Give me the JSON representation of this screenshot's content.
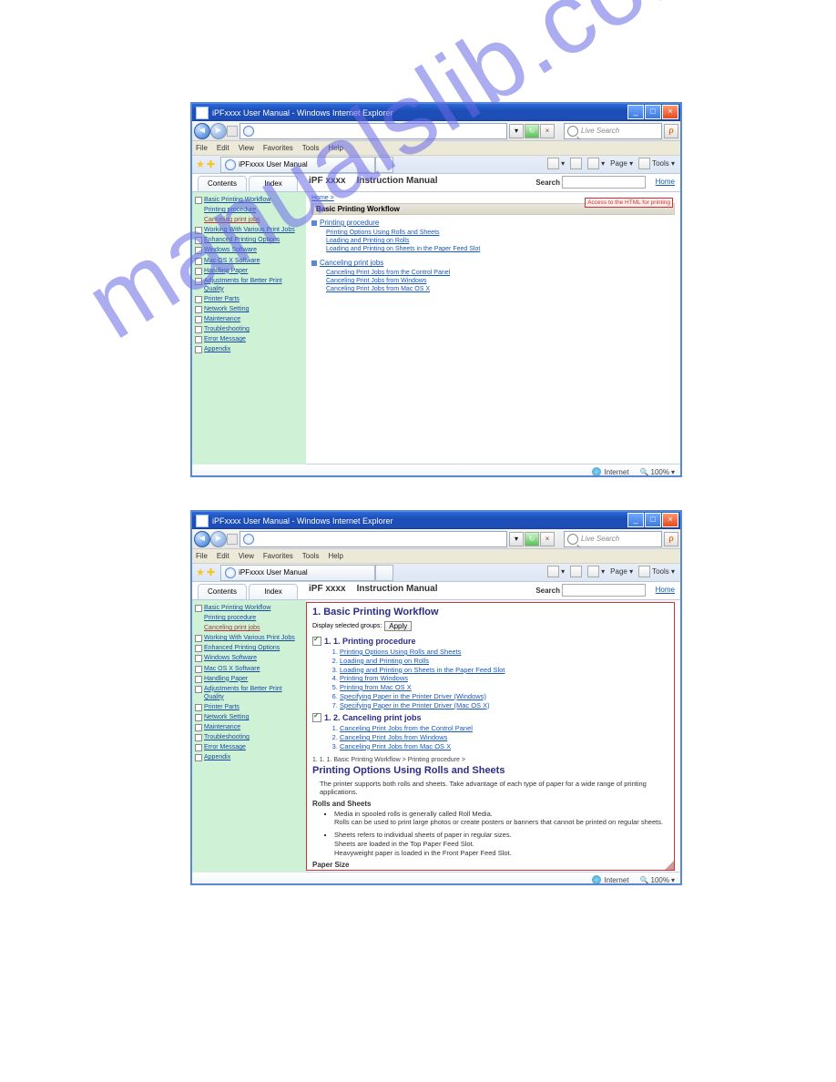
{
  "watermark": "manualslib.com",
  "win": {
    "title": "iPFxxxx User Manual - Windows Internet Explorer",
    "searchPlaceholder": "Live Search",
    "menus": [
      "File",
      "Edit",
      "View",
      "Favorites",
      "Tools",
      "Help"
    ],
    "tabTitle": "iPFxxxx User Manual",
    "tools": {
      "page": "Page ▾",
      "tools": "Tools ▾"
    }
  },
  "manual": {
    "tabContents": "Contents",
    "tabIndex": "Index",
    "product": "iPF xxxx",
    "subtitle": "Instruction Manual",
    "searchLabel": "Search",
    "home": "Home"
  },
  "sidebar": [
    {
      "type": "top",
      "label": "Basic Printing Workflow"
    },
    {
      "type": "sub",
      "label": "Printing procedure"
    },
    {
      "type": "subred",
      "label": "Canceling print jobs"
    },
    {
      "type": "top",
      "label": "Working With Various Print Jobs"
    },
    {
      "type": "top",
      "label": "Enhanced Printing Options"
    },
    {
      "type": "top",
      "label": "Windows Software"
    },
    {
      "type": "top",
      "label": "Mac OS X Software"
    },
    {
      "type": "top",
      "label": "Handling Paper"
    },
    {
      "type": "top",
      "label": "Adjustments for Better Print Quality"
    },
    {
      "type": "top",
      "label": "Printer Parts"
    },
    {
      "type": "top",
      "label": "Network Setting"
    },
    {
      "type": "top",
      "label": "Maintenance"
    },
    {
      "type": "top",
      "label": "Troubleshooting"
    },
    {
      "type": "top",
      "label": "Error Message"
    },
    {
      "type": "top",
      "label": "Appendix"
    }
  ],
  "shot1": {
    "crumb": "Home >",
    "heading": "Basic Printing Workflow",
    "redbox": "Access to the HTML for printing",
    "sec1": "Printing procedure",
    "sec1Links": [
      "Printing Options Using Rolls and Sheets",
      "Loading and Printing on Rolls",
      "Loading and Printing on Sheets in the Paper Feed Slot"
    ],
    "sec2": "Canceling print jobs",
    "sec2Links": [
      "Canceling Print Jobs from the Control Panel",
      "Canceling Print Jobs from Windows",
      "Canceling Print Jobs from Mac OS X"
    ]
  },
  "shot2": {
    "h1": "1. Basic Printing Workflow",
    "displaySel": "Display selected groups:",
    "apply": "Apply",
    "g1": "1. 1. Printing procedure",
    "g1list": [
      "Printing Options Using Rolls and Sheets",
      "Loading and Printing on Rolls",
      "Loading and Printing on Sheets in the Paper Feed Slot",
      "Printing from Windows",
      "Printing from Mac OS X",
      "Specifying Paper in the Printer Driver (Windows)",
      "Specifying Paper in the Printer Driver (Mac OS X)"
    ],
    "g2": "1. 2. Canceling print jobs",
    "g2list": [
      "Canceling Print Jobs from the Control Panel",
      "Canceling Print Jobs from Windows",
      "Canceling Print Jobs from Mac OS X"
    ],
    "bcrumb": "1. 1. 1.  Basic Printing Workflow > Printing procedure >",
    "h2": "Printing Options Using Rolls and Sheets",
    "intro": "The printer supports both rolls and sheets. Take advantage of each type of paper for a wide range of printing applications.",
    "sub1": "Rolls and Sheets",
    "bullets": [
      "Media in spooled rolls is generally called Roll Media.\nRolls can be used to print large photos or create posters or banners that cannot be printed on regular sheets.",
      "Sheets refers to individual sheets of paper in regular sizes.\nSheets are loaded in the Top Paper Feed Slot.\nHeavyweight paper is loaded in the Front Paper Feed Slot."
    ],
    "sub2": "Paper Size"
  },
  "status": {
    "internet": "Internet",
    "zoom": "100%"
  }
}
